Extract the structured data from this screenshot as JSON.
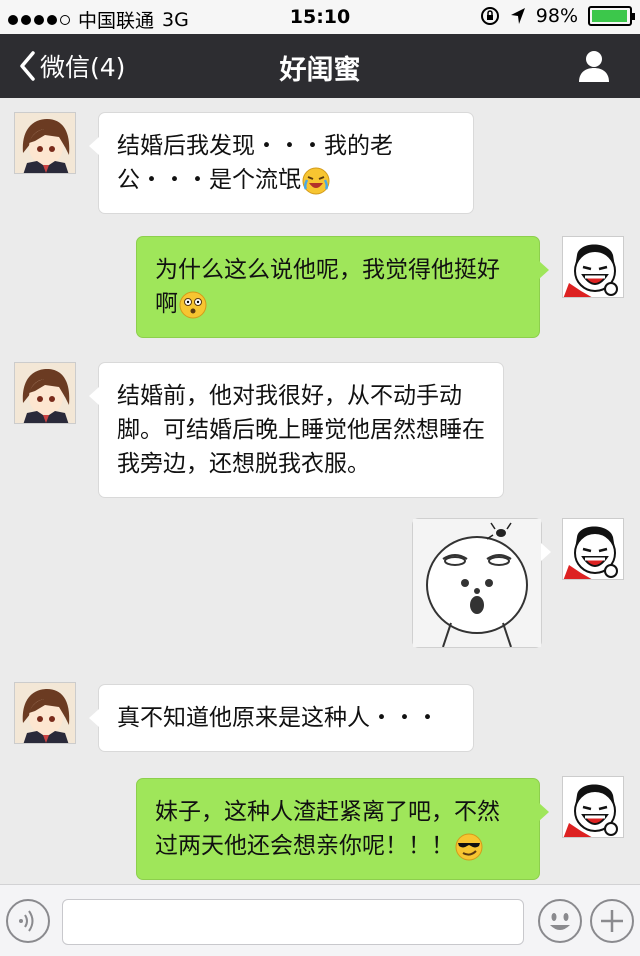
{
  "status_bar": {
    "carrier": "中国联通",
    "network": "3G",
    "time": "15:10",
    "battery": "98%",
    "battery_level": 0.98,
    "battery_color": "#3cc74b"
  },
  "nav": {
    "back_label": "微信(4)",
    "title": "好闺蜜",
    "profile_icon": "person-icon"
  },
  "messages": [
    {
      "side": "in",
      "text": "结婚后我发现・・・我的老公・・・是个流氓",
      "emoji": "laughing-crying-emoji"
    },
    {
      "side": "out",
      "text": "为什么这么说他呢，我觉得他挺好啊",
      "emoji": "surprised-emoji"
    },
    {
      "side": "in",
      "text": "结婚前，他对我很好，从不动手动脚。可结婚后晚上睡觉他居然想睡在我旁边，还想脱我衣服。"
    },
    {
      "side": "out",
      "type": "sticker",
      "sticker": "blank-face-fly-sticker"
    },
    {
      "side": "in",
      "text": "真不知道他原来是这种人・・・"
    },
    {
      "side": "out",
      "text": "妹子，这种人渣赶紧离了吧，不然过两天他还会想亲你呢！！！",
      "emoji": "sunglasses-emoji"
    }
  ],
  "input_bar": {
    "voice_icon": "voice-icon",
    "emoji_icon": "smiley-icon",
    "add_icon": "plus-icon"
  },
  "colors": {
    "nav_bg": "#2d2d31",
    "chat_bg": "#ebebeb",
    "out_bubble": "#9fe65a",
    "in_bubble": "#ffffff"
  }
}
